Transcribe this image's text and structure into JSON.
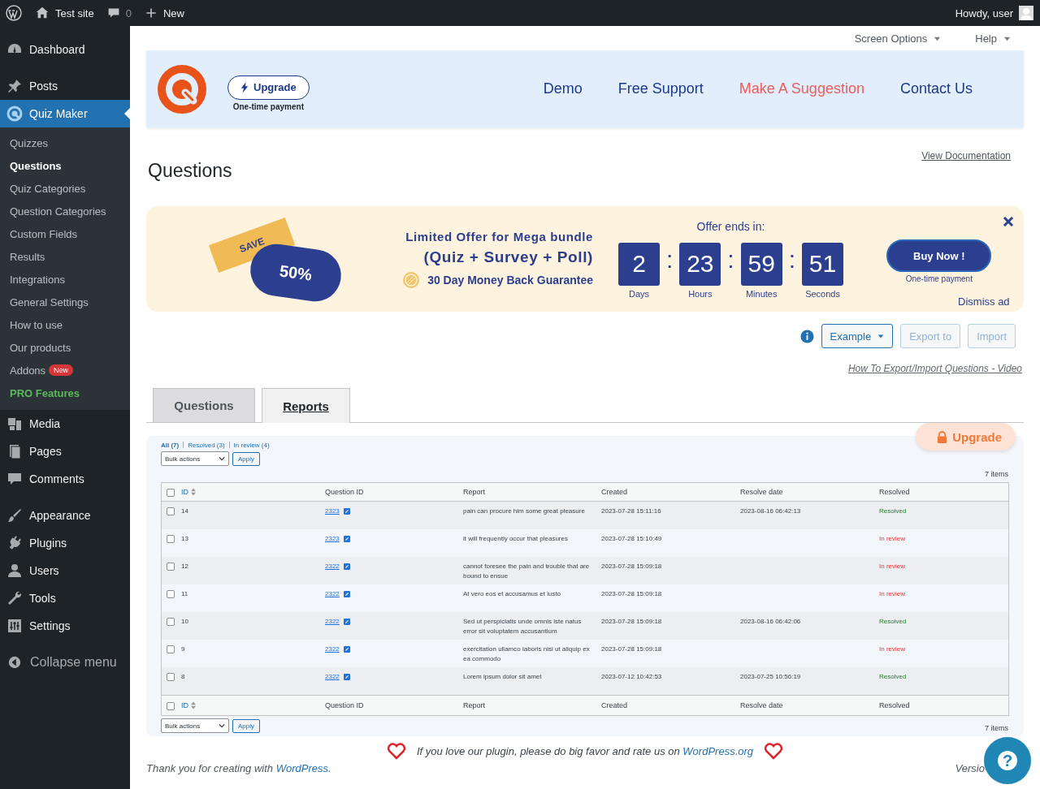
{
  "admin_bar": {
    "site": "Test site",
    "comments": "0",
    "new": "New",
    "greeting": "Howdy, user"
  },
  "sidebar": {
    "groups": [
      [
        {
          "label": "Dashboard",
          "selected": false
        }
      ],
      [
        {
          "label": "Posts",
          "selected": false
        },
        {
          "label": "Quiz Maker",
          "selected": true,
          "children": [
            {
              "label": "Quizzes",
              "kind": "link",
              "selected": false
            },
            {
              "label": "Questions",
              "kind": "link",
              "selected": true
            },
            {
              "label": "Quiz Categories",
              "kind": "link",
              "selected": false
            },
            {
              "label": "Question Categories",
              "kind": "link",
              "selected": false
            },
            {
              "label": "Custom Fields",
              "kind": "link",
              "selected": false
            },
            {
              "label": "Results",
              "kind": "link",
              "selected": false
            },
            {
              "label": "Integrations",
              "kind": "link",
              "selected": false
            },
            {
              "label": "General Settings",
              "kind": "link",
              "selected": false
            },
            {
              "label": "How to use",
              "kind": "link",
              "selected": false
            },
            {
              "label": "Our products",
              "kind": "link",
              "selected": false
            },
            {
              "label": "Addons",
              "kind": "link",
              "selected": false,
              "badge": "New"
            },
            {
              "label": "PRO Features",
              "kind": "pro",
              "selected": false
            }
          ]
        },
        {
          "label": "Media",
          "selected": false
        },
        {
          "label": "Pages",
          "selected": false
        },
        {
          "label": "Comments",
          "selected": false
        }
      ],
      [
        {
          "label": "Appearance",
          "selected": false
        },
        {
          "label": "Plugins",
          "selected": false
        },
        {
          "label": "Users",
          "selected": false
        },
        {
          "label": "Tools",
          "selected": false
        },
        {
          "label": "Settings",
          "selected": false
        }
      ]
    ],
    "collapse": "Collapse menu"
  },
  "screen_meta": [
    "Screen Options",
    "Help"
  ],
  "plugin_header": {
    "upgrade": "Upgrade",
    "upgrade_note": "One-time payment",
    "nav": [
      {
        "label": "Demo",
        "highlighted": false
      },
      {
        "label": "Free Support",
        "highlighted": false
      },
      {
        "label": "Make A Suggestion",
        "highlighted": true
      },
      {
        "label": "Contact Us",
        "highlighted": false
      }
    ]
  },
  "page": {
    "title": "Questions",
    "doc_link": "View Documentation"
  },
  "promo": {
    "ribbon": "SAVE",
    "discount": "50%",
    "title": "Limited Offer for Mega bundle",
    "bundle": "(Quiz + Survey + Poll)",
    "guarantee": "30 Day Money Back Guarantee",
    "offer_label": "Offer ends in:",
    "countdown": [
      {
        "value": "2",
        "unit": "Days"
      },
      {
        "value": "23",
        "unit": "Hours"
      },
      {
        "value": "59",
        "unit": "Minutes"
      },
      {
        "value": "51",
        "unit": "Seconds"
      }
    ],
    "separator": ":",
    "buy": "Buy Now !",
    "buy_note": "One-time payment",
    "dismiss": "Dismiss ad"
  },
  "toolbar": {
    "buttons": [
      {
        "label": "Example",
        "kind": "dropdown",
        "disabled": false
      },
      {
        "label": "Export to",
        "kind": "plain",
        "disabled": true
      },
      {
        "label": "Import",
        "kind": "plain",
        "disabled": true
      }
    ],
    "video_link": "How To Export/Import Questions - Video"
  },
  "tabs": [
    {
      "label": "Questions",
      "selected": false
    },
    {
      "label": "Reports",
      "selected": true
    }
  ],
  "reports": {
    "upgrade": "Upgrade",
    "filters": [
      {
        "label": "All (7)",
        "selected": true
      },
      {
        "label": "Resolved (3)",
        "selected": false
      },
      {
        "label": "In review (4)",
        "selected": false
      }
    ],
    "bulk_action": "Bulk actions",
    "apply": "Apply",
    "count": "7 items",
    "select_all_checked": false,
    "columns": [
      "ID",
      "Question ID",
      "Report",
      "Created",
      "Resolve date",
      "Resolved"
    ],
    "footer_select_all_checked": false,
    "footer_columns": [
      "ID",
      "Question ID",
      "Report",
      "Created",
      "Resolve date",
      "Resolved"
    ],
    "bottom_bulk_action": "Bulk actions",
    "bottom_apply": "Apply",
    "bottom_count": "7 items",
    "rows": [
      {
        "id": "14",
        "question": "2323",
        "report": "pain can procure him some great pleasure",
        "created": "2023-07-28 15:11:16",
        "resolve_date": "2023-08-16 06:42:13",
        "status": "Resolved",
        "resolved": true,
        "checked": false
      },
      {
        "id": "13",
        "question": "2323",
        "report": "it will frequently occur that pleasures",
        "created": "2023-07-28 15:10:49",
        "status": "In review",
        "resolved": false,
        "checked": false
      },
      {
        "id": "12",
        "question": "2322",
        "report": "cannot foresee the pain and trouble that are bound to ensue",
        "created": "2023-07-28 15:09:18",
        "status": "In review",
        "resolved": false,
        "checked": false
      },
      {
        "id": "11",
        "question": "2322",
        "report": "At vero eos et accusamus et iusto",
        "created": "2023-07-28 15:09:18",
        "status": "In review",
        "resolved": false,
        "checked": false
      },
      {
        "id": "10",
        "question": "2322",
        "report": "Sed ut perspiciatis unde omnis iste natus error sit voluptatem accusantium",
        "created": "2023-07-28 15:09:18",
        "resolve_date": "2023-08-16 06:42:06",
        "status": "Resolved",
        "resolved": true,
        "checked": false
      },
      {
        "id": "9",
        "question": "2322",
        "report": "exercitation ullamco laboris nisi ut aliquip ex ea commodo",
        "created": "2023-07-28 15:09:18",
        "status": "In review",
        "resolved": false,
        "checked": false
      },
      {
        "id": "8",
        "question": "2322",
        "report": "Lorem ipsum dolor sit amet",
        "created": "2023-07-12 10:42:53",
        "resolve_date": "2023-07-25 10:56:19",
        "status": "Resolved",
        "resolved": true,
        "checked": false
      }
    ]
  },
  "footer": {
    "rate_text": "If you love our plugin, please do big favor and rate us on",
    "rate_link": "WordPress.org",
    "thanks_before": "Thank you for creating with",
    "thanks_link": "WordPress",
    "thanks_after": ".",
    "version": "Versio",
    "help": "?"
  }
}
